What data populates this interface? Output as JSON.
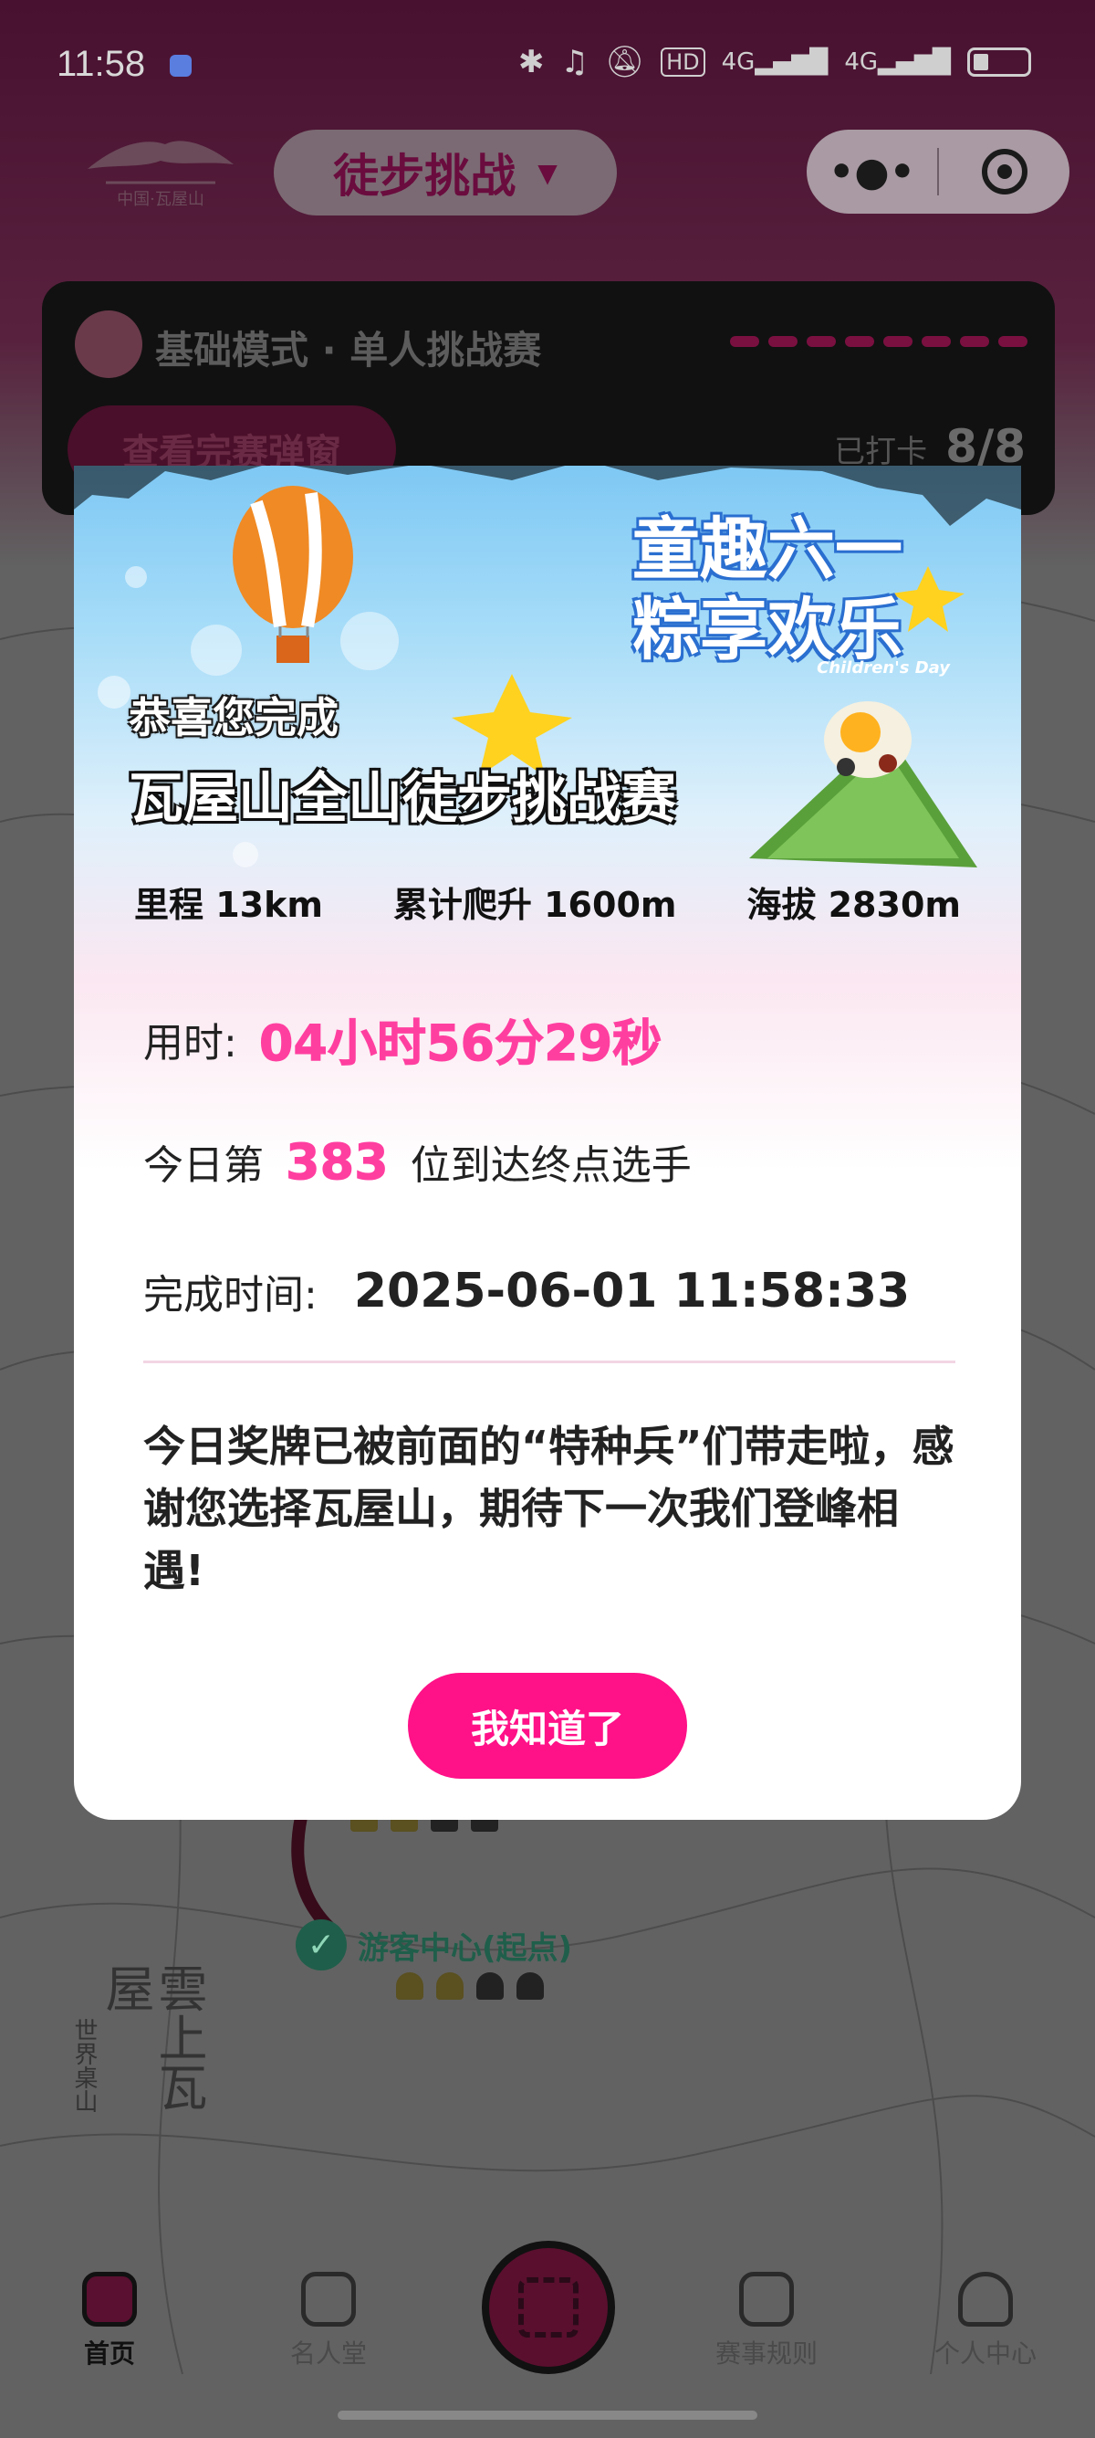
{
  "status_bar": {
    "time": "11:58",
    "icons": [
      "bluetooth-icon",
      "headphones-icon",
      "mute-icon",
      "hd-icon",
      "signal-4g-icon",
      "signal-4g-icon",
      "battery-icon"
    ],
    "hd_label": "HD",
    "net1": "4G",
    "net2": "4G"
  },
  "header": {
    "mode_selector": "徒步挑战",
    "logo_alt": "中国·瓦屋山",
    "capsule": {
      "more_icon": "more-dots-icon",
      "close_icon": "target-icon"
    }
  },
  "challenge_card": {
    "mode_text": "基础模式 · 单人挑战赛",
    "view_button": "查看完赛弹窗",
    "checked_label": "已打卡",
    "checked_value": "8/8",
    "progress_segments": 8
  },
  "map": {
    "start_node": "游客中心(起点)",
    "brand_big": "雲上瓦屋",
    "brand_small": "世界桌山"
  },
  "modal": {
    "banner_line1": "童趣六一",
    "banner_line2": "粽享欢乐",
    "banner_en": "Children's Day",
    "congrats": "恭喜您完成",
    "event_name": "瓦屋山全山徒步挑战赛",
    "stats": [
      {
        "label": "里程 13km"
      },
      {
        "label": "累计爬升 1600m"
      },
      {
        "label": "海拔 2830m"
      }
    ],
    "time_label": "用时:",
    "time_value": "04小时56分29秒",
    "rank_prefix": "今日第",
    "rank_value": "383",
    "rank_suffix": "位到达终点选手",
    "finish_label": "完成时间:",
    "finish_value": "2025-06-01 11:58:33",
    "message": "今日奖牌已被前面的“特种兵”们带走啦，感谢您选择瓦屋山，期待下一次我们登峰相遇!",
    "ok_button": "我知道了",
    "accent_color": "#ff1188",
    "highlight_color": "#ff3fa0"
  },
  "tabbar": {
    "tabs": [
      {
        "label": "首页",
        "icon": "home-icon",
        "active": true
      },
      {
        "label": "名人堂",
        "icon": "trophy-icon",
        "active": false
      },
      {
        "label": "",
        "icon": "scan-icon",
        "active": false
      },
      {
        "label": "赛事规则",
        "icon": "rules-icon",
        "active": false
      },
      {
        "label": "个人中心",
        "icon": "user-icon",
        "active": false
      }
    ]
  }
}
